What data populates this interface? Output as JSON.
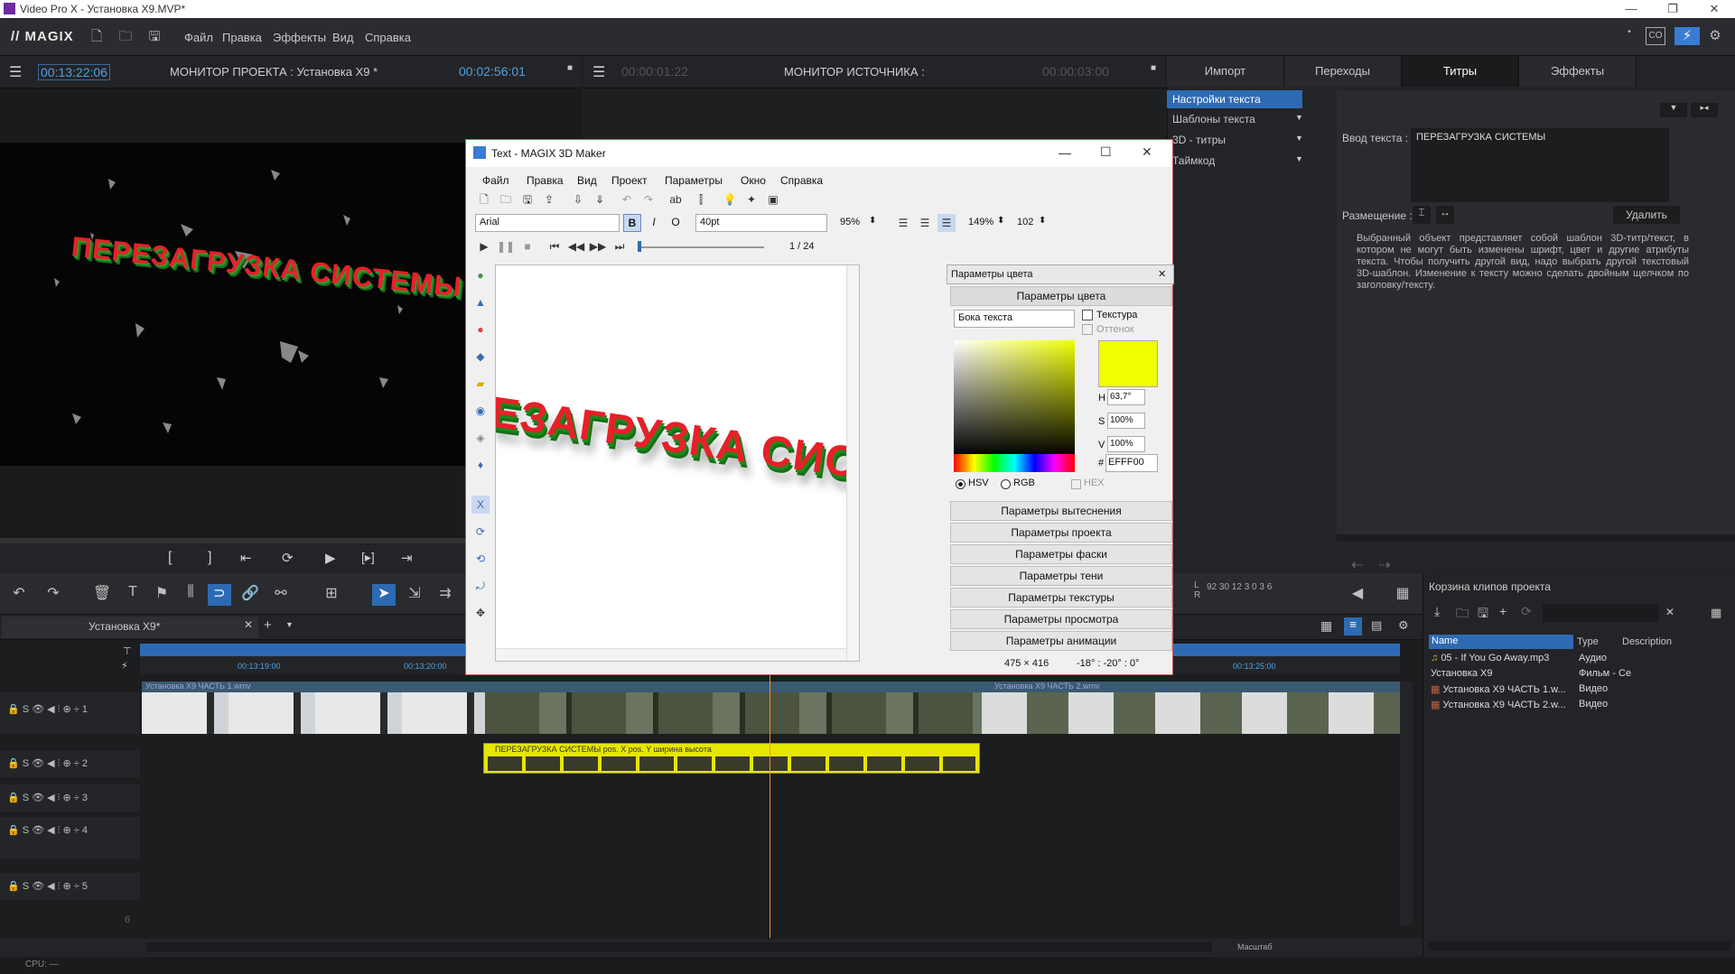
{
  "window": {
    "title": "Video Pro X - Установка X9.MVP*"
  },
  "menubar": {
    "logo": "// MAGIX",
    "items": [
      "Файл",
      "Правка",
      "Эффекты",
      "Вид",
      "Справка"
    ]
  },
  "project_monitor": {
    "timecode_left": "00:13:22:06",
    "title": "МОНИТОР  ПРОЕКТА : Установка X9 *",
    "timecode_right": "00:02:56:01",
    "overlay_text": "ПЕРЕЗАГРУЗКА СИСТЕМЫ"
  },
  "source_monitor": {
    "timecode_left": "00:00:01:22",
    "title": "МОНИТОР  ИСТОЧНИКА :",
    "timecode_right": "00:00:03:00"
  },
  "right_panel": {
    "tabs": [
      "Импорт",
      "Переходы",
      "Титры",
      "Эффекты"
    ],
    "active_tab": "Титры",
    "list_items": [
      "Настройки текста",
      "Шаблоны текста",
      "3D - титры",
      "Таймкод"
    ],
    "text_input_label": "Ввод текста :",
    "text_input_value": "ПЕРЕЗАГРУЗКА СИСТЕМЫ",
    "placement_label": "Размещение :",
    "delete_button": "Удалить",
    "info_text": "Выбранный объект представляет собой шаблон 3D-титр/текст, в котором не могут быть изменены шрифт, цвет и другие атрибуты текста. Чтобы получить другой вид, надо выбрать другой текстовый 3D-шаблон. Изменение к тексту можно сделать двойным щелчком по заголовку/тексту."
  },
  "dialog": {
    "title": "Text - MAGIX 3D Maker",
    "menu": [
      "Файл",
      "Правка",
      "Вид",
      "Проект",
      "Параметры",
      "Окно",
      "Справка"
    ],
    "font": "Arial",
    "size": "40pt",
    "zoom1": "95%",
    "zoom2": "149%",
    "zoom3": "102",
    "frame": "1 / 24",
    "preview_text": "ЕЗАГРУЗКА СИСТЕ",
    "color_panel_title": "Параметры цвета",
    "color_section": "Параметры цвета",
    "side_select": "Бока текста",
    "texture_label": "Текстура",
    "tint_label": "Оттенок",
    "h_label": "H",
    "h_value": "63,7°",
    "s_label": "S",
    "s_value": "100%",
    "v_label": "V",
    "v_value": "100%",
    "hex_label": "#",
    "hex_value": "EFFF00",
    "mode_hsv": "HSV",
    "mode_rgb": "RGB",
    "mode_hex": "HEX",
    "sections": [
      "Параметры вытеснения",
      "Параметры проекта",
      "Параметры фаски",
      "Параметры тени",
      "Параметры текстуры",
      "Параметры просмотра",
      "Параметры анимации"
    ],
    "status_size": "475 × 416",
    "status_rot": "-18° : -20° : 0°"
  },
  "timeline": {
    "tab": "Установка X9*",
    "ruler": [
      "00:13:19:00",
      "00:13:20:00",
      "00:13:25:00"
    ],
    "clip1": "Установка X9 ЧАСТЬ 1.wmv",
    "clip2": "Установка X9 ЧАСТЬ 2.wmv",
    "title_clip": "ПЕРЕЗАГРУЗКА СИСТЕМЫ  pos. X  pos. Y  ширина  высота",
    "tracks": [
      "1",
      "2",
      "3",
      "4",
      "5",
      "6"
    ],
    "scale_label": "Масштаб"
  },
  "bin": {
    "title": "Корзина клипов проекта",
    "columns": [
      "Name",
      "Type",
      "Description"
    ],
    "rows": [
      {
        "name": "05 - If You Go Away.mp3",
        "type": "Аудио"
      },
      {
        "name": "Установка X9",
        "type": "Фильм - Се"
      },
      {
        "name": "Установка X9 ЧАСТЬ 1.w...",
        "type": "Видео"
      },
      {
        "name": "Установка X9 ЧАСТЬ 2.w...",
        "type": "Видео"
      }
    ]
  },
  "status": {
    "cpu": "CPU: —"
  },
  "colors": {
    "accent": "#4fa3e0",
    "title_yellow": "#efff00",
    "text_red": "#e8202a"
  }
}
